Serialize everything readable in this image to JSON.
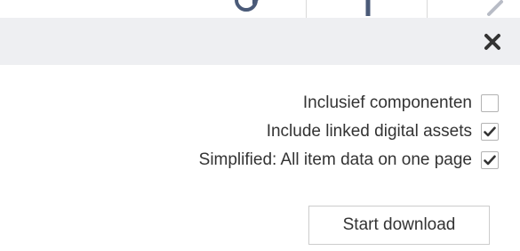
{
  "toolbar": {
    "icons": [
      "refresh-icon",
      "pin-icon",
      "edit-icon"
    ]
  },
  "header": {
    "close_icon": "close-icon"
  },
  "options": [
    {
      "label": "Inclusief componenten",
      "checked": false
    },
    {
      "label": "Include linked digital assets",
      "checked": true
    },
    {
      "label": "Simplified: All item data on one page",
      "checked": true
    }
  ],
  "download_button": {
    "label": "Start download"
  }
}
